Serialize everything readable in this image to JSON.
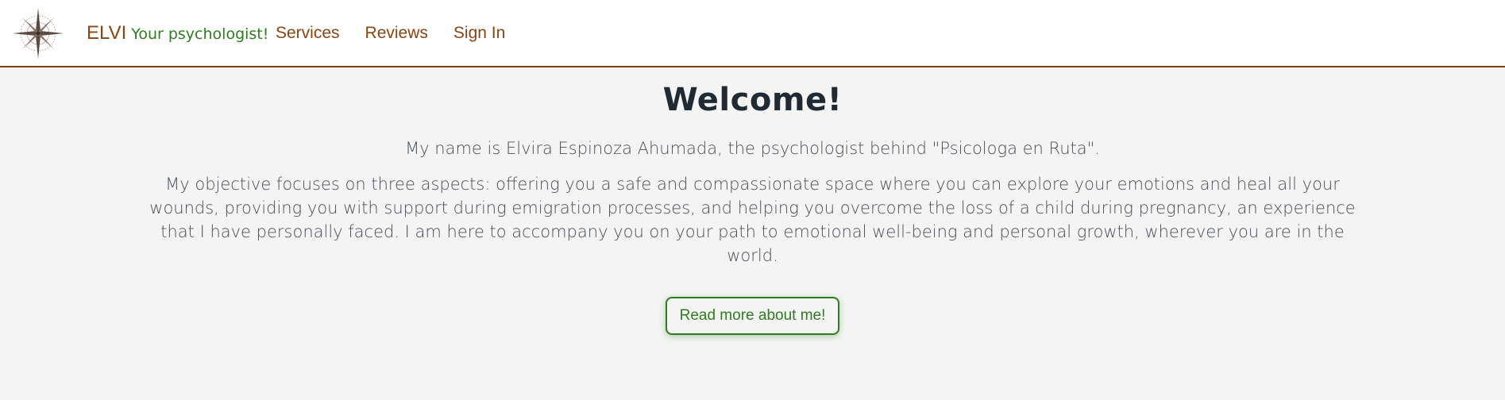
{
  "header": {
    "logo_icon": "compass-rose-icon",
    "brand_name": "ELVI",
    "brand_tagline": "Your psychologist!",
    "nav": [
      {
        "label": "Services"
      },
      {
        "label": "Reviews"
      },
      {
        "label": "Sign In"
      }
    ]
  },
  "main": {
    "title": "Welcome!",
    "intro": "My name is Elvira Espinoza Ahumada, the psychologist behind \"Psicologa en Ruta\".",
    "objective": "My objective focuses on three aspects: offering you a safe and compassionate space where you can explore your emotions and heal all your wounds, providing you with support during emigration processes, and helping you overcome the loss of a child during pregnancy, an experience that I have personally faced. I am here to accompany you on your path to emotional well-being and personal growth, wherever you are in the world.",
    "cta_label": "Read more about me!"
  },
  "colors": {
    "brand_brown": "#8b4513",
    "accent_green": "#2e7d1f",
    "background": "#f4f4f4",
    "heading": "#1f2a33"
  }
}
